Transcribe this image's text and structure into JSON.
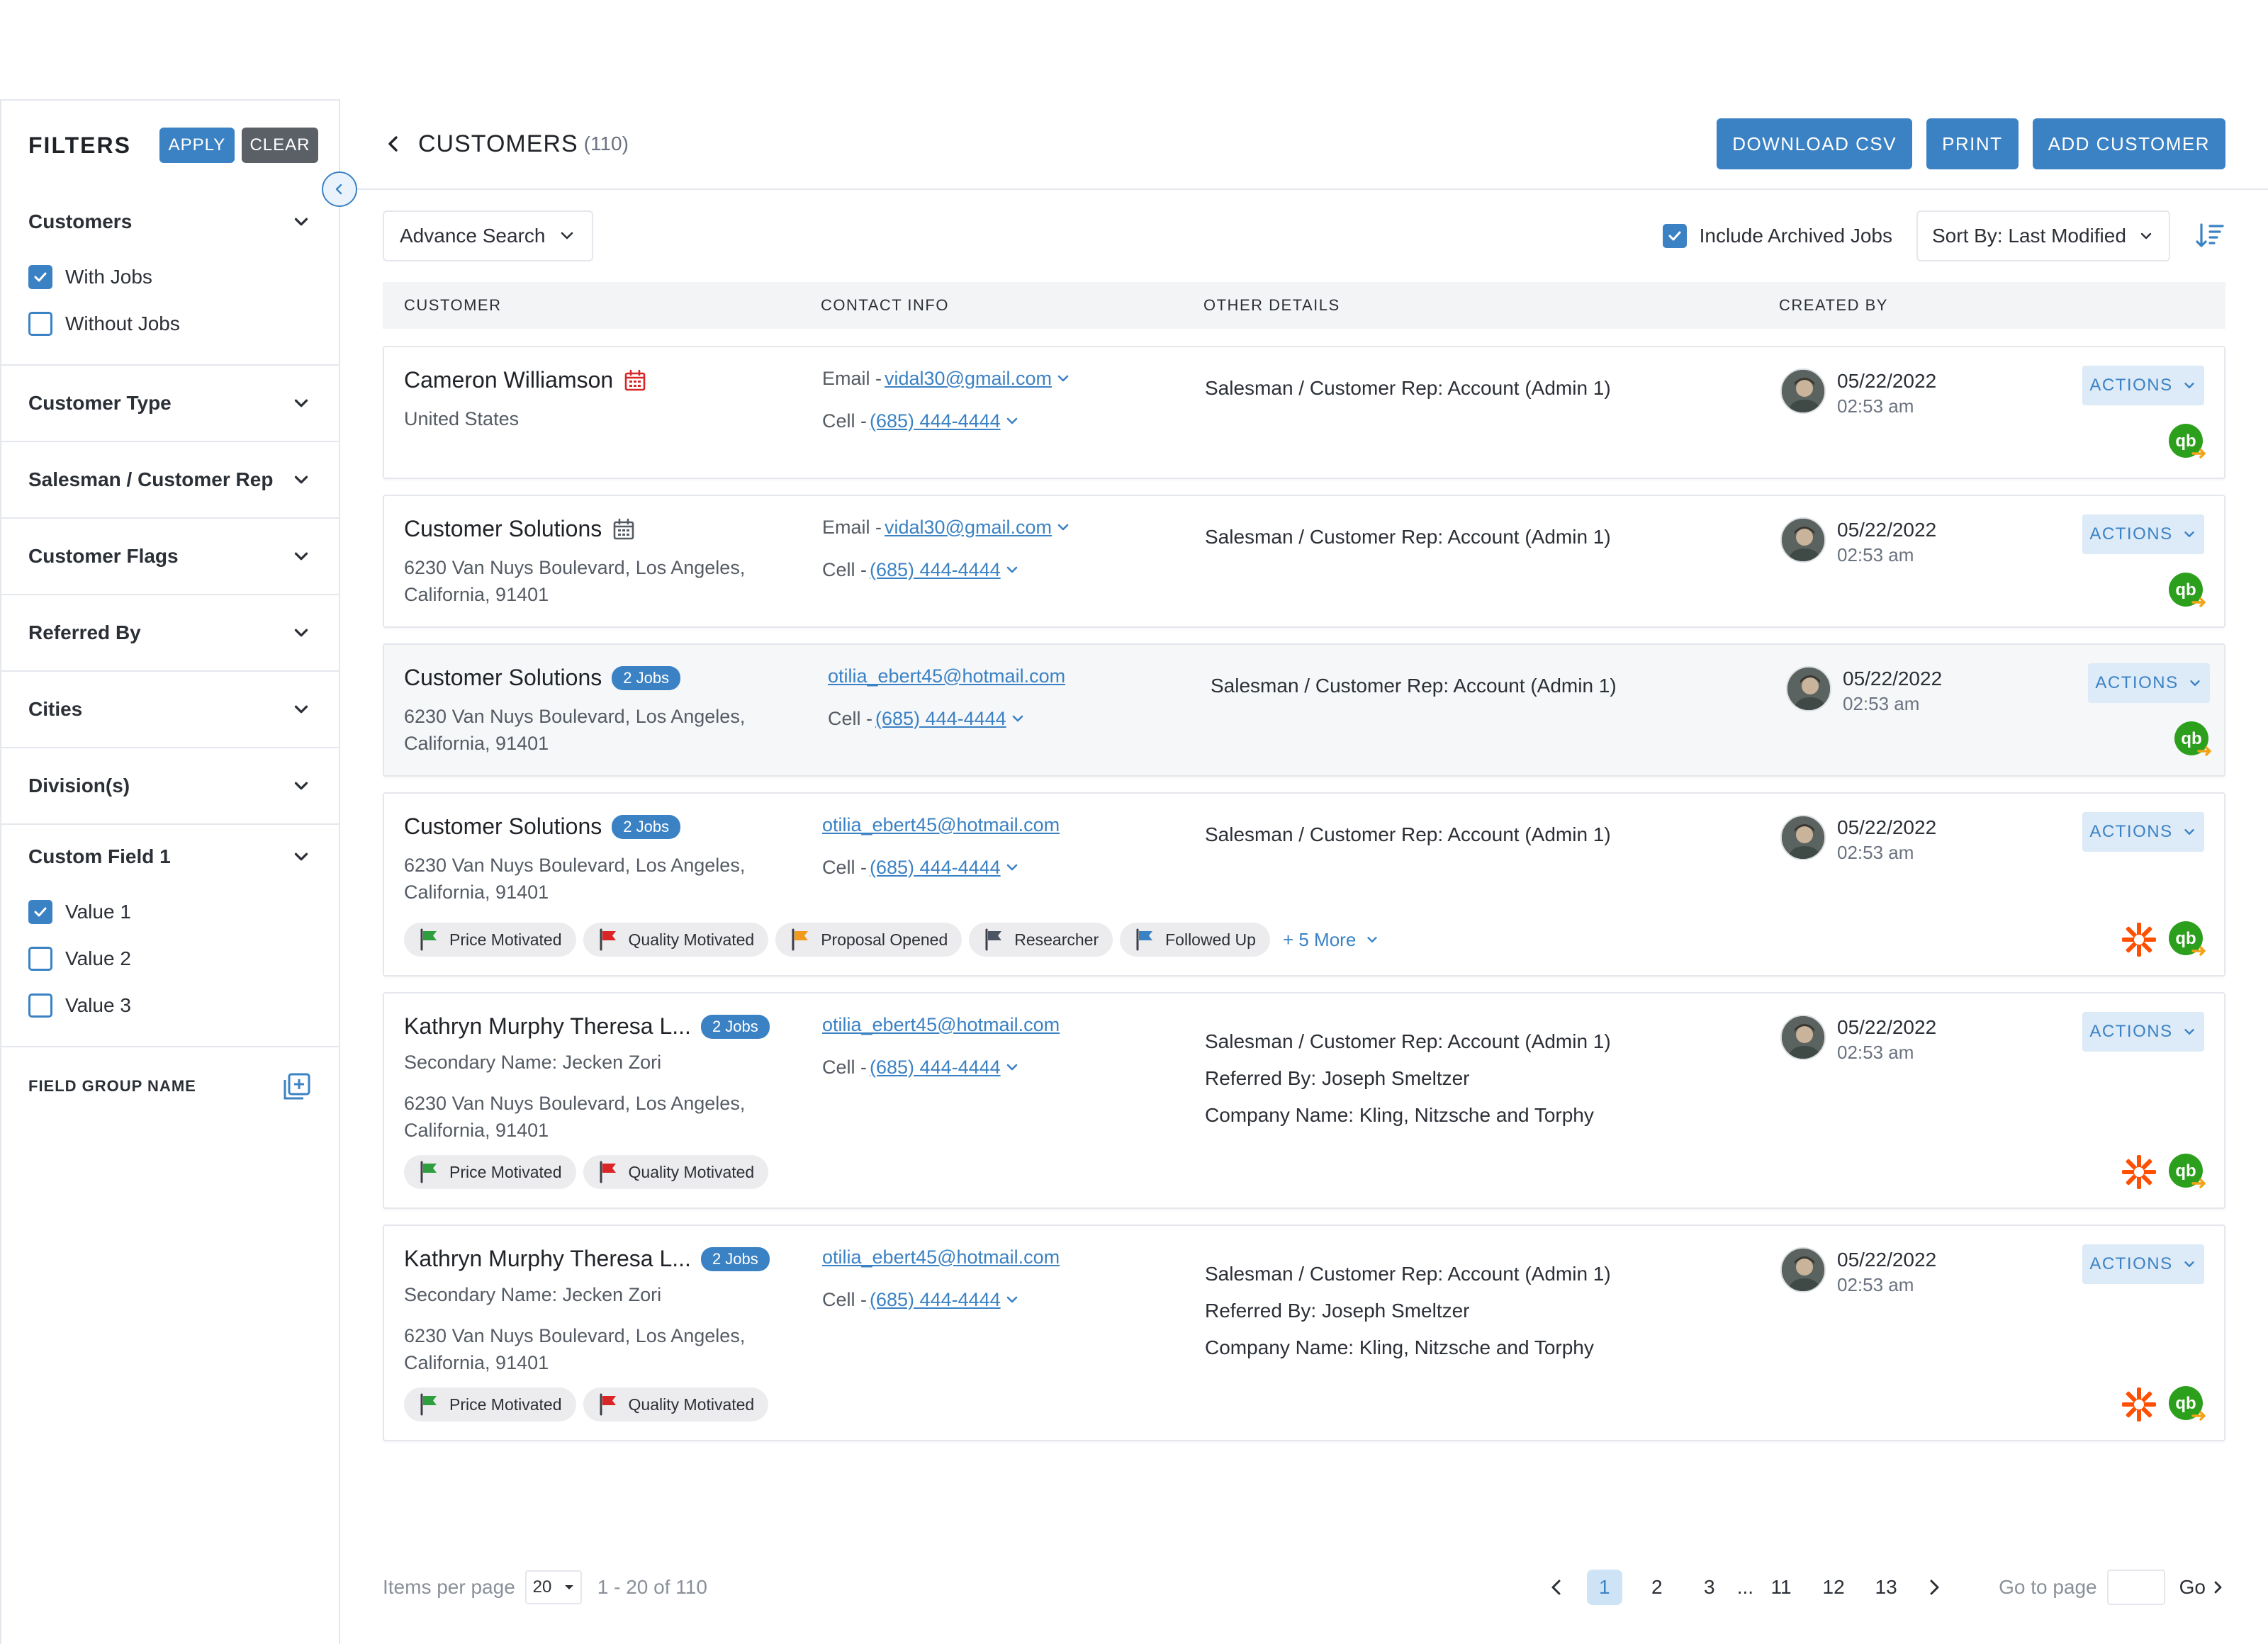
{
  "sidebar": {
    "title": "FILTERS",
    "apply_label": "APPLY",
    "clear_label": "CLEAR",
    "sections": [
      {
        "label": "Customers",
        "options": [
          {
            "label": "With Jobs",
            "checked": true
          },
          {
            "label": "Without Jobs",
            "checked": false
          }
        ]
      },
      {
        "label": "Customer Type"
      },
      {
        "label": "Salesman / Customer Rep"
      },
      {
        "label": "Customer Flags"
      },
      {
        "label": "Referred By"
      },
      {
        "label": "Cities"
      },
      {
        "label": "Division(s)"
      },
      {
        "label": "Custom Field 1",
        "options": [
          {
            "label": "Value 1",
            "checked": true
          },
          {
            "label": "Value 2",
            "checked": false
          },
          {
            "label": "Value 3",
            "checked": false
          }
        ]
      }
    ],
    "field_group_label": "FIELD GROUP NAME"
  },
  "header": {
    "title": "CUSTOMERS",
    "count": "(110)",
    "download_label": "DOWNLOAD CSV",
    "print_label": "PRINT",
    "add_label": "ADD CUSTOMER"
  },
  "toolbar": {
    "advance_search_label": "Advance Search",
    "include_archived_label": "Include Archived Jobs",
    "include_archived_checked": true,
    "sort_label": "Sort By: Last Modified"
  },
  "table": {
    "columns": [
      "CUSTOMER",
      "CONTACT INFO",
      "OTHER DETAILS",
      "CREATED BY"
    ],
    "actions_label": "ACTIONS",
    "rows": [
      {
        "name": "Cameron Williamson",
        "badge_icon": "calendar-red",
        "address": [
          "United States"
        ],
        "email_prefix": "Email - ",
        "email": "vidal30@gmail.com",
        "cell_prefix": "Cell - ",
        "cell": "(685) 444-4444",
        "other": [
          "Salesman / Customer Rep:  Account (Admin 1)"
        ],
        "date": "05/22/2022",
        "time": "02:53 am"
      },
      {
        "name": "Customer Solutions",
        "badge_icon": "calendar-gray",
        "address": [
          "6230 Van Nuys Boulevard, Los Angeles,",
          "California, 91401"
        ],
        "email_prefix": "Email - ",
        "email": "vidal30@gmail.com",
        "cell_prefix": "Cell - ",
        "cell": "(685) 444-4444",
        "other": [
          "Salesman / Customer Rep:  Account (Admin 1)"
        ],
        "date": "05/22/2022",
        "time": "02:53 am"
      },
      {
        "name": "Customer Solutions",
        "jobs": "2 Jobs",
        "address": [
          "6230 Van Nuys Boulevard, Los Angeles,",
          "California, 91401"
        ],
        "email": "otilia_ebert45@hotmail.com",
        "cell_prefix": "Cell - ",
        "cell": "(685) 444-4444",
        "other": [
          "Salesman / Customer Rep:  Account (Admin 1)"
        ],
        "date": "05/22/2022",
        "time": "02:53 am"
      },
      {
        "name": "Customer Solutions",
        "jobs": "2 Jobs",
        "address": [
          "6230 Van Nuys Boulevard, Los Angeles,",
          "California, 91401"
        ],
        "email": "otilia_ebert45@hotmail.com",
        "cell_prefix": "Cell - ",
        "cell": "(685) 444-4444",
        "other": [
          "Salesman / Customer Rep:  Account (Admin 1)"
        ],
        "date": "05/22/2022",
        "time": "02:53 am",
        "tags": [
          {
            "label": "Price Motivated",
            "color": "#2e9e3f"
          },
          {
            "label": "Quality Motivated",
            "color": "#d92525"
          },
          {
            "label": "Proposal Opened",
            "color": "#f29a1f"
          },
          {
            "label": "Researcher",
            "color": "#4b5563"
          },
          {
            "label": "Followed Up",
            "color": "#3b82c4"
          }
        ],
        "more_label": "+ 5 More"
      },
      {
        "name": "Kathryn Murphy Theresa L...",
        "jobs": "2 Jobs",
        "secondary": "Secondary Name: Jecken Zori",
        "address": [
          "6230 Van Nuys Boulevard, Los Angeles,",
          "California, 91401"
        ],
        "email": "otilia_ebert45@hotmail.com",
        "cell_prefix": "Cell - ",
        "cell": "(685) 444-4444",
        "other": [
          "Salesman / Customer Rep:  Account (Admin 1)",
          "Referred By: Joseph Smeltzer",
          "Company Name: Kling, Nitzsche and Torphy"
        ],
        "date": "05/22/2022",
        "time": "02:53 am",
        "tags": [
          {
            "label": "Price Motivated",
            "color": "#2e9e3f"
          },
          {
            "label": "Quality Motivated",
            "color": "#d92525"
          }
        ]
      },
      {
        "name": "Kathryn Murphy Theresa L...",
        "jobs": "2 Jobs",
        "secondary": "Secondary Name: Jecken Zori",
        "address": [
          "6230 Van Nuys Boulevard, Los Angeles,",
          "California, 91401"
        ],
        "email": "otilia_ebert45@hotmail.com",
        "cell_prefix": "Cell - ",
        "cell": "(685) 444-4444",
        "other": [
          "Salesman / Customer Rep:  Account (Admin 1)",
          "Referred By: Joseph Smeltzer",
          "Company Name: Kling, Nitzsche and Torphy"
        ],
        "date": "05/22/2022",
        "time": "02:53 am",
        "tags": [
          {
            "label": "Price Motivated",
            "color": "#2e9e3f"
          },
          {
            "label": "Quality Motivated",
            "color": "#d92525"
          }
        ]
      }
    ]
  },
  "pagination": {
    "items_per_page_label": "Items per page",
    "items_per_page": "20",
    "range": "1 - 20 of 110",
    "pages": [
      "1",
      "2",
      "3",
      "...",
      "11",
      "12",
      "13"
    ],
    "current_page": "1",
    "goto_label": "Go to page",
    "go_label": "Go"
  },
  "colors": {
    "accent": "#3b82c4",
    "border": "#e4e7ec",
    "quickbooks": "#2ca01c",
    "zapier": "#ff4f00"
  }
}
